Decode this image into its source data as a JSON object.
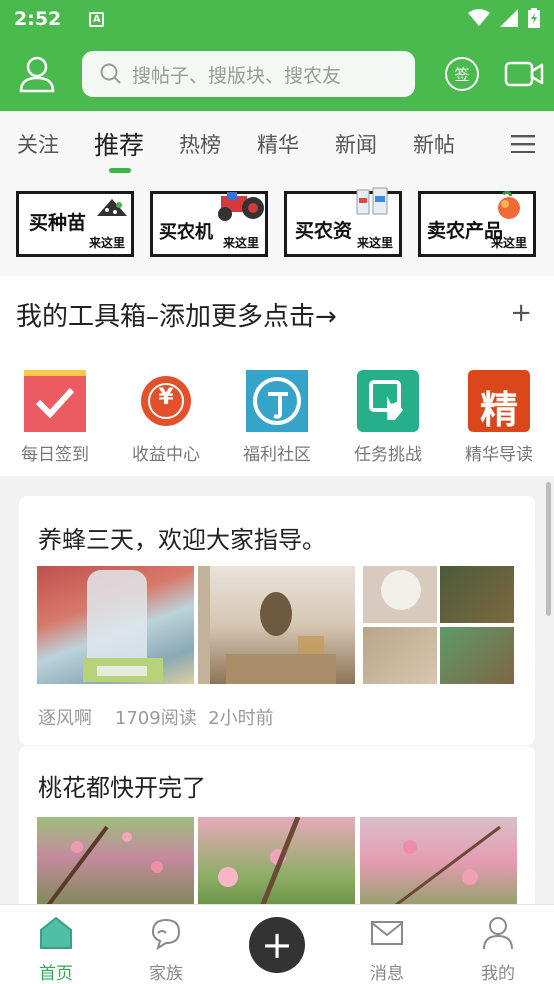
{
  "status": {
    "time": "2:52",
    "a_badge": "A"
  },
  "search": {
    "placeholder": "搜帖子、搜版块、搜农友"
  },
  "header": {
    "sign_label": "签"
  },
  "tabs": [
    "关注",
    "推荐",
    "热榜",
    "精华",
    "新闻",
    "新帖"
  ],
  "active_tab": "推荐",
  "banners": [
    {
      "title": "买种苗",
      "sub": "来这里"
    },
    {
      "title": "买农机",
      "sub": "来这里"
    },
    {
      "title": "买农资",
      "sub": "来这里"
    },
    {
      "title": "卖农产品",
      "sub": "来这里"
    }
  ],
  "toolbox": {
    "title": "我的工具箱–添加更多点击→",
    "plus": "+",
    "items": [
      {
        "label": "每日签到",
        "icon": "checkin-icon",
        "color": "#ec5a62"
      },
      {
        "label": "收益中心",
        "icon": "yuan-icon",
        "color": "#e2512b",
        "glyph": "¥"
      },
      {
        "label": "福利社区",
        "icon": "welfare-icon",
        "color": "#36a3c9"
      },
      {
        "label": "任务挑战",
        "icon": "task-icon",
        "color": "#26b08a"
      },
      {
        "label": "精华导读",
        "icon": "jinghua-icon",
        "color": "#d9471b",
        "glyph": "精"
      }
    ]
  },
  "posts": [
    {
      "title": "养蜂三天，欢迎大家指导。",
      "author": "逐风啊",
      "reads": "1709阅读",
      "time": "2小时前"
    },
    {
      "title": "桃花都快开完了"
    }
  ],
  "bottom_nav": [
    {
      "label": "首页",
      "icon": "home-icon",
      "active": true
    },
    {
      "label": "家族",
      "icon": "chat-icon",
      "active": false
    },
    {
      "label": "消息",
      "icon": "mail-icon",
      "active": false
    },
    {
      "label": "我的",
      "icon": "person-icon",
      "active": false
    }
  ],
  "add_button": "+",
  "colors": {
    "brand_green": "#4ab94e",
    "tab_indicator": "#3cb548",
    "nav_active": "#35a55a"
  }
}
